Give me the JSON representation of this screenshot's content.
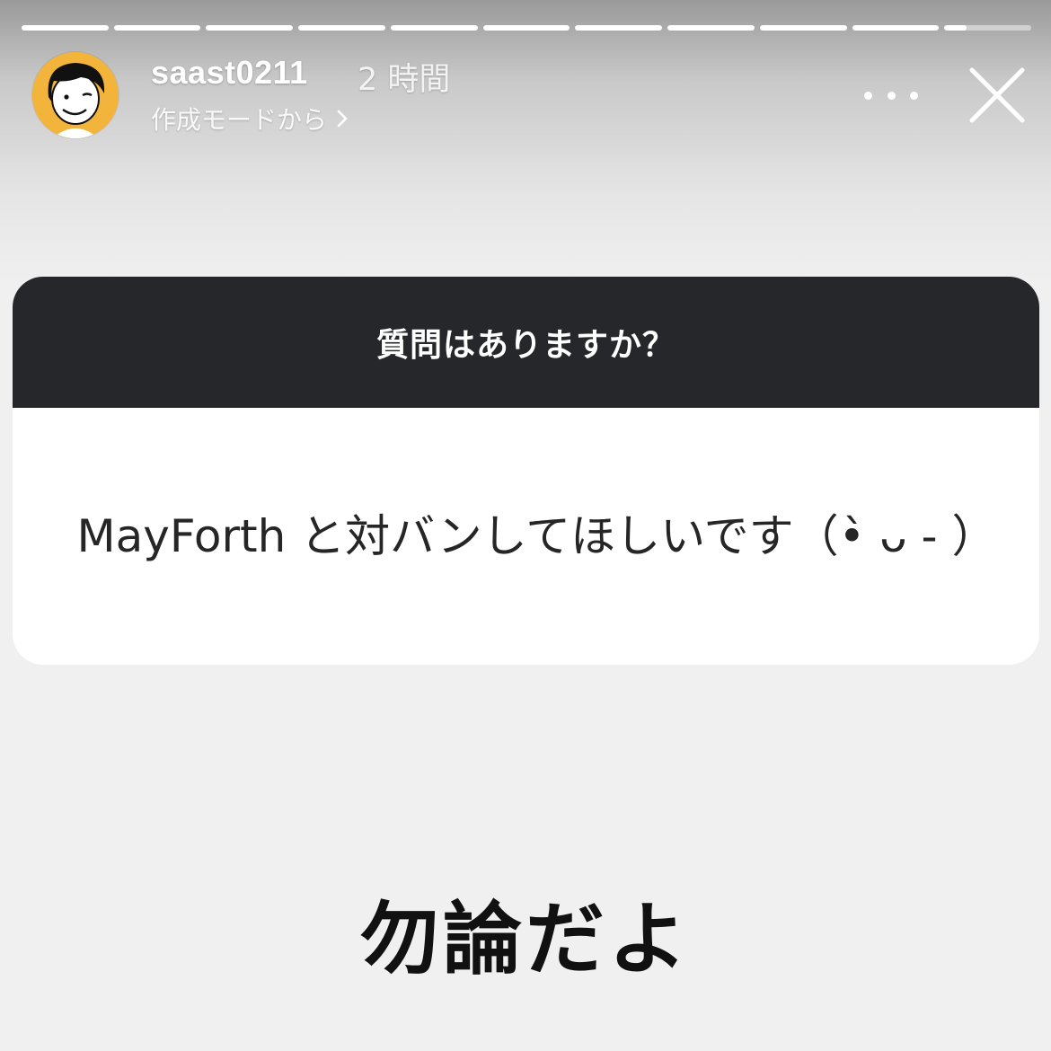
{
  "story": {
    "segments_total": 11,
    "segments_completed": 10,
    "current_segment_progress": 0.25
  },
  "header": {
    "username": "saast0211",
    "time": "2 時間",
    "subtitle": "作成モードから"
  },
  "question_card": {
    "prompt": "質問はありますか？",
    "question": "MayForth と対バンしてほしいです（•̀ ᴗ - ）"
  },
  "answer_text": "勿論だよ",
  "colors": {
    "card_header": "#26272b",
    "avatar_bg": "#f2b43a"
  },
  "icons": {
    "more": "more-horizontal-icon",
    "close": "close-icon",
    "subtitle_arrow": "chevron-right-icon"
  }
}
